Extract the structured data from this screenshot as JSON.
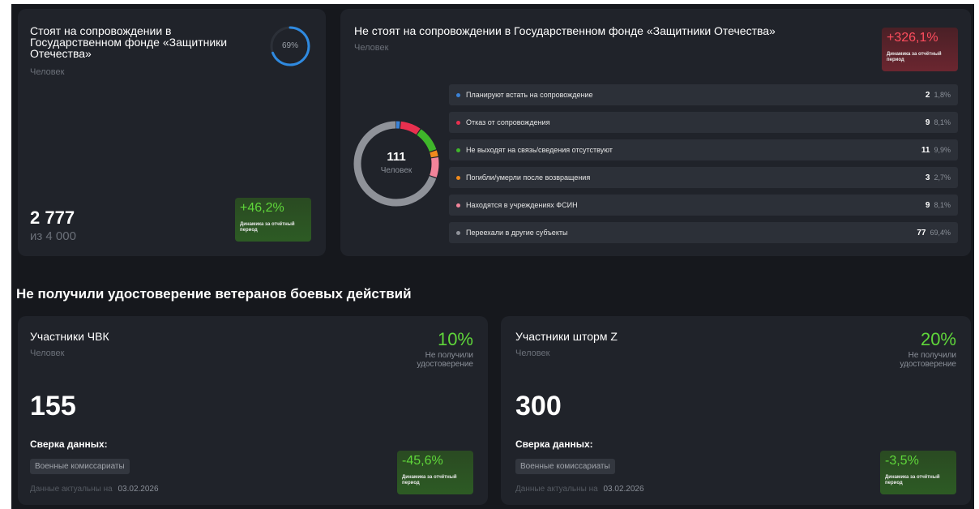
{
  "card1": {
    "title": "Стоят на сопровождении в Государственном фонде «Защитники Отечества»",
    "unit": "Человек",
    "progress_percent": 69,
    "progress_label": "69%",
    "value": "2 777",
    "total": "из 4 000",
    "dynamics_value": "+46,2%",
    "dynamics_label": "Динамика за отчётный период"
  },
  "card2": {
    "title": "Не стоят на сопровождении в Государственном фонде «Защитники Отечества»",
    "unit": "Человек",
    "dynamics_value": "+326,1%",
    "dynamics_label": "Динамика за отчётный период",
    "donut_total": "111",
    "donut_unit": "Человек",
    "items": [
      {
        "label": "Планируют встать на сопровождение",
        "count": "2",
        "percent": "1,8%",
        "value": 2,
        "color": "#3b82d6"
      },
      {
        "label": "Отказ от сопровождения",
        "count": "9",
        "percent": "8,1%",
        "value": 9,
        "color": "#e8304f"
      },
      {
        "label": "Не выходят на связь/сведения отсутствуют",
        "count": "11",
        "percent": "9,9%",
        "value": 11,
        "color": "#3fb62a"
      },
      {
        "label": "Погибли/умерли после возвращения",
        "count": "3",
        "percent": "2,7%",
        "value": 3,
        "color": "#f08a1c"
      },
      {
        "label": "Находятся в учреждениях ФСИН",
        "count": "9",
        "percent": "8,1%",
        "value": 9,
        "color": "#f2849a"
      },
      {
        "label": "Переехали в другие субъекты",
        "count": "77",
        "percent": "69,4%",
        "value": 77,
        "color": "#8f9299"
      }
    ]
  },
  "section_title": "Не получили удостоверение ветеранов боевых действий",
  "card3": {
    "title": "Участники ЧВК",
    "unit": "Человек",
    "percent": "10%",
    "percent_label_1": "Не получили",
    "percent_label_2": "удостоверение",
    "value": "155",
    "sverka_label": "Сверка данных:",
    "tag": "Военные комиссариаты",
    "actual_prefix": "Данные актуальны на",
    "actual_date": "03.02.2026",
    "dynamics_value": "-45,6%",
    "dynamics_label": "Динамика за отчётный период"
  },
  "card4": {
    "title": "Участники шторм Z",
    "unit": "Человек",
    "percent": "20%",
    "percent_label_1": "Не получили",
    "percent_label_2": "удостоверение",
    "value": "300",
    "sverka_label": "Сверка данных:",
    "tag": "Военные комиссариаты",
    "actual_prefix": "Данные актуальны на",
    "actual_date": "03.02.2026",
    "dynamics_value": "-3,5%",
    "dynamics_label": "Динамика за отчётный период"
  }
}
